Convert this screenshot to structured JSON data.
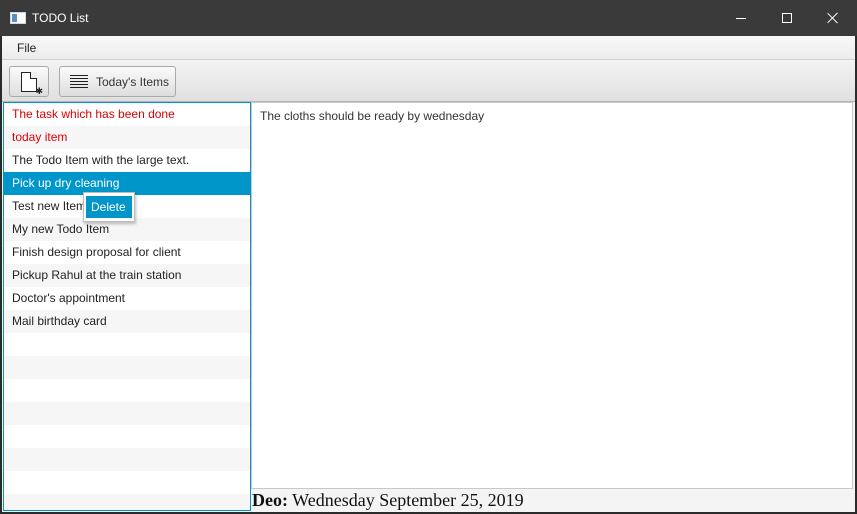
{
  "window": {
    "title": "TODO List",
    "controls": {
      "minimize_icon": "minimize-icon",
      "maximize_icon": "maximize-icon",
      "close_icon": "close-icon"
    }
  },
  "menu": {
    "file_label": "File"
  },
  "toolbar": {
    "new_item_icon": "new-document-icon",
    "today_label": "Today's Items",
    "today_icon": "align-lines-icon"
  },
  "todo_list": {
    "items": [
      {
        "label": "The task which has been done",
        "style": "done"
      },
      {
        "label": "today item",
        "style": "done"
      },
      {
        "label": "The Todo Item with the large text.",
        "style": "normal"
      },
      {
        "label": "Pick up dry cleaning",
        "style": "selected"
      },
      {
        "label": "Test new Item",
        "style": "normal"
      },
      {
        "label": "My new Todo Item",
        "style": "normal"
      },
      {
        "label": "Finish design proposal for client",
        "style": "normal"
      },
      {
        "label": "Pickup Rahul at the train station",
        "style": "normal"
      },
      {
        "label": "Doctor's appointment",
        "style": "normal"
      },
      {
        "label": "Mail birthday card",
        "style": "normal"
      },
      {
        "label": "",
        "style": "empty"
      },
      {
        "label": "",
        "style": "empty"
      },
      {
        "label": "",
        "style": "empty"
      },
      {
        "label": "",
        "style": "empty"
      },
      {
        "label": "",
        "style": "empty"
      },
      {
        "label": "",
        "style": "empty"
      },
      {
        "label": "",
        "style": "empty"
      },
      {
        "label": "",
        "style": "empty"
      }
    ]
  },
  "context_menu": {
    "delete_label": "Delete"
  },
  "details": {
    "text": "The cloths should be ready by wednesday",
    "deadline_label": "Deo:",
    "deadline_value": "Wednesday September 25, 2019"
  },
  "colors": {
    "selection": "#0096c9",
    "done_text": "#e00000",
    "title_bar": "#3a3a3a"
  }
}
